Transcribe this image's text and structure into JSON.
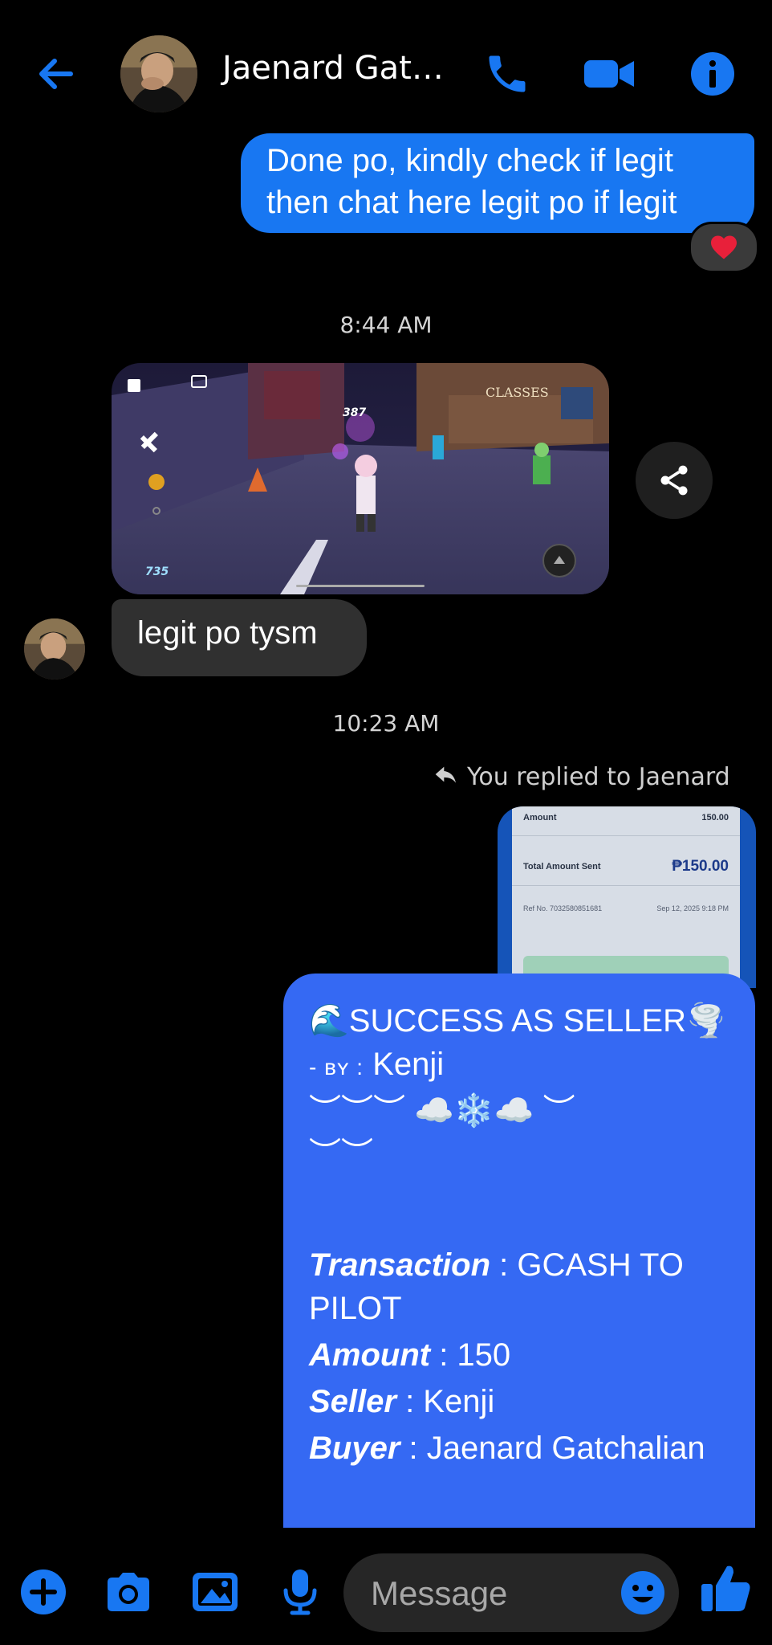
{
  "header": {
    "contact_name": "Jaenard Gat…",
    "icons": [
      "back-arrow-icon",
      "phone-icon",
      "video-call-icon",
      "info-icon"
    ]
  },
  "messages": {
    "sent_1": {
      "line1": "Done po, kindly check if legit",
      "line2": "then chat here legit po if legit",
      "reaction": "❤️"
    },
    "time_1": "8:44 AM",
    "game_screenshot": {
      "classes_sign": "CLASSES",
      "score_counter": "387",
      "currency_counter": "735"
    },
    "received_1": "legit po tysm",
    "time_2": "10:23 AM",
    "reply_note": "You replied to Jaenard",
    "receipt_preview": {
      "amount_label": "Amount",
      "amount_value": "150.00",
      "total_label": "Total Amount Sent",
      "total_value": "₱150.00",
      "ref_label": "Ref No. 7032580851681",
      "date": "Sep 12, 2025 9:18 PM"
    },
    "sent_2": {
      "title": "🌊SUCCESS AS SELLER🌪️",
      "by_prefix": "- ʙʏ :",
      "by_name": " Kenji",
      "deco_line1": "︶︶︶ ☁️❄️☁️ ︶",
      "deco_line2": "︶︶",
      "transaction_label": "Transaction",
      "transaction_value": " : GCASH TO PILOT",
      "amount_label": "Amount",
      "amount_value": " : 150",
      "seller_label": "Seller",
      "seller_value": " : Kenji",
      "buyer_label": "Buyer",
      "buyer_value": " : Jaenard Gatchalian"
    }
  },
  "composer": {
    "placeholder": "Message",
    "icons": [
      "plus-icon",
      "camera-icon",
      "gallery-icon",
      "microphone-icon",
      "emoji-icon",
      "like-icon"
    ]
  },
  "colors": {
    "accent": "#1877f2",
    "outgoing_bubble": "#1877f2",
    "incoming_bubble": "#303030",
    "highlight_bubble": "#3569f3",
    "background": "#000000"
  }
}
